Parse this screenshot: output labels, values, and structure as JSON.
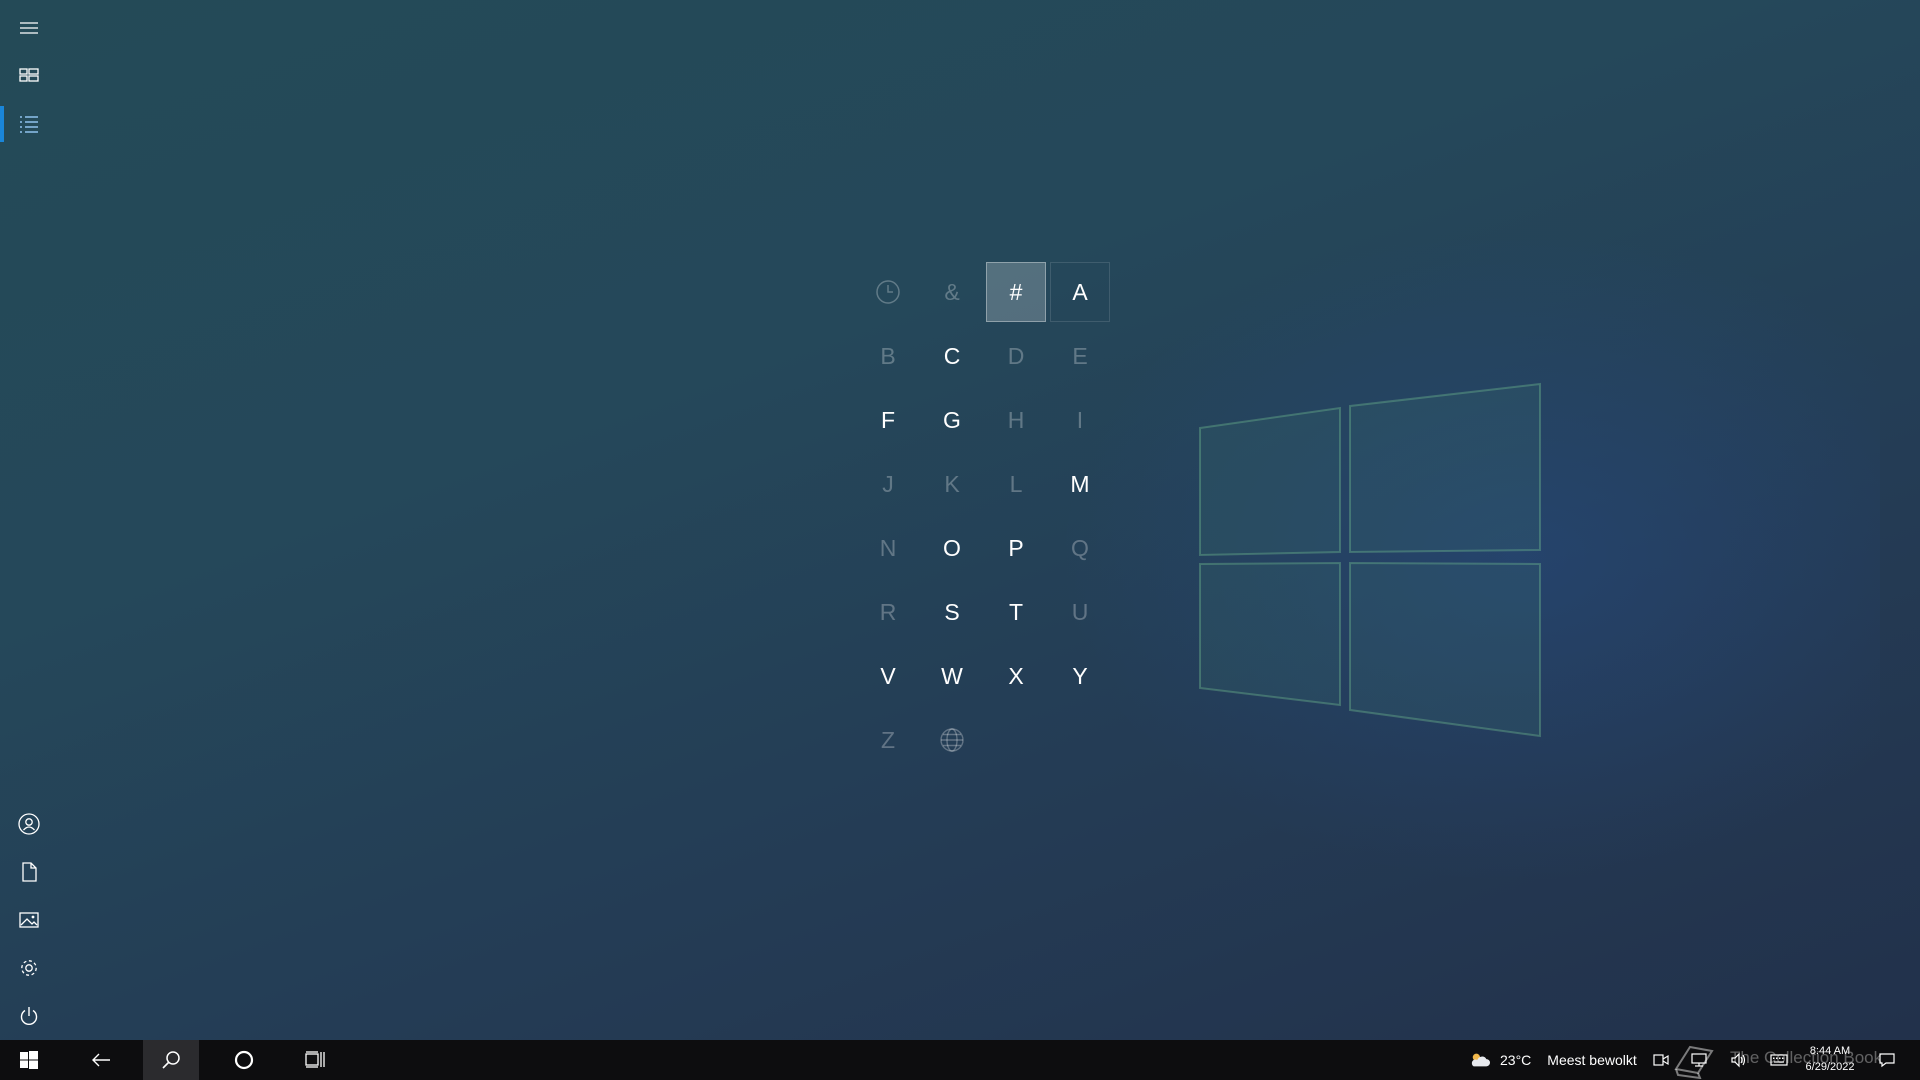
{
  "jump_list": {
    "cells": [
      {
        "label": "",
        "icon": "clock-icon",
        "state": "dim"
      },
      {
        "label": "&",
        "state": "dim"
      },
      {
        "label": "#",
        "state": "selected"
      },
      {
        "label": "A",
        "state": "active-hover"
      },
      {
        "label": "B",
        "state": "dim"
      },
      {
        "label": "C",
        "state": "active"
      },
      {
        "label": "D",
        "state": "dim"
      },
      {
        "label": "E",
        "state": "dim"
      },
      {
        "label": "F",
        "state": "active"
      },
      {
        "label": "G",
        "state": "active"
      },
      {
        "label": "H",
        "state": "dim"
      },
      {
        "label": "I",
        "state": "dim"
      },
      {
        "label": "J",
        "state": "dim"
      },
      {
        "label": "K",
        "state": "dim"
      },
      {
        "label": "L",
        "state": "dim"
      },
      {
        "label": "M",
        "state": "active"
      },
      {
        "label": "N",
        "state": "dim"
      },
      {
        "label": "O",
        "state": "active"
      },
      {
        "label": "P",
        "state": "active"
      },
      {
        "label": "Q",
        "state": "dim"
      },
      {
        "label": "R",
        "state": "dim"
      },
      {
        "label": "S",
        "state": "active"
      },
      {
        "label": "T",
        "state": "active"
      },
      {
        "label": "U",
        "state": "dim"
      },
      {
        "label": "V",
        "state": "active"
      },
      {
        "label": "W",
        "state": "active"
      },
      {
        "label": "X",
        "state": "active"
      },
      {
        "label": "Y",
        "state": "active"
      },
      {
        "label": "Z",
        "state": "dim"
      },
      {
        "label": "",
        "icon": "globe-icon",
        "state": "dim"
      }
    ]
  },
  "rail": {
    "top_items": [
      "hamburger-menu-icon",
      "tiles-view-icon",
      "all-apps-list-icon"
    ],
    "active_item": "all-apps-list-icon",
    "bottom_items": [
      "user-account-icon",
      "documents-icon",
      "pictures-icon",
      "settings-gear-icon",
      "power-icon"
    ]
  },
  "taskbar": {
    "weather": {
      "temp": "23°C",
      "description": "Meest bewolkt"
    },
    "clock": {
      "time": "8:44 AM",
      "date": "6/29/2022"
    },
    "watermark": "The Collection Book"
  },
  "colors": {
    "accent": "#1a86d9",
    "taskbar_bg": "#0d0d0f",
    "background": "#244a57"
  }
}
